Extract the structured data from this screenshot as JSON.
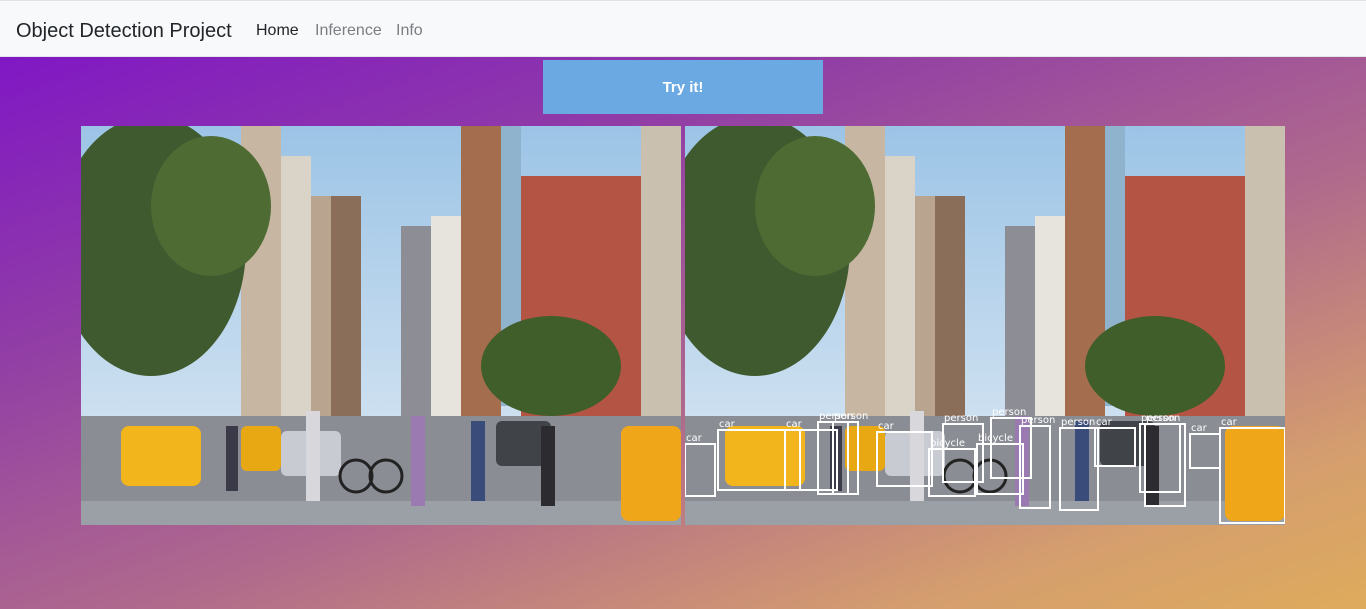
{
  "navbar": {
    "brand": "Object Detection Project",
    "links": [
      {
        "label": "Home",
        "active": true
      },
      {
        "label": "Inference",
        "active": false
      },
      {
        "label": "Info",
        "active": false
      }
    ]
  },
  "hero": {
    "button_label": "Try it!"
  },
  "images": {
    "original": "street-photo",
    "annotated": "street-photo-with-detections"
  },
  "detections": [
    {
      "label": "car"
    },
    {
      "label": "car"
    },
    {
      "label": "car"
    },
    {
      "label": "person"
    },
    {
      "label": "person"
    },
    {
      "label": "car"
    },
    {
      "label": "person"
    },
    {
      "label": "bicycle"
    },
    {
      "label": "bicycle"
    },
    {
      "label": "person"
    },
    {
      "label": "person"
    },
    {
      "label": "person"
    },
    {
      "label": "car"
    },
    {
      "label": "person"
    },
    {
      "label": "person"
    },
    {
      "label": "car"
    },
    {
      "label": "car"
    }
  ],
  "colors": {
    "button": "#6aa9e1",
    "navbar_bg": "#f8f9fa",
    "gradient_start": "#7d10cb",
    "gradient_end": "#deab5c",
    "box": "#ffffff"
  }
}
